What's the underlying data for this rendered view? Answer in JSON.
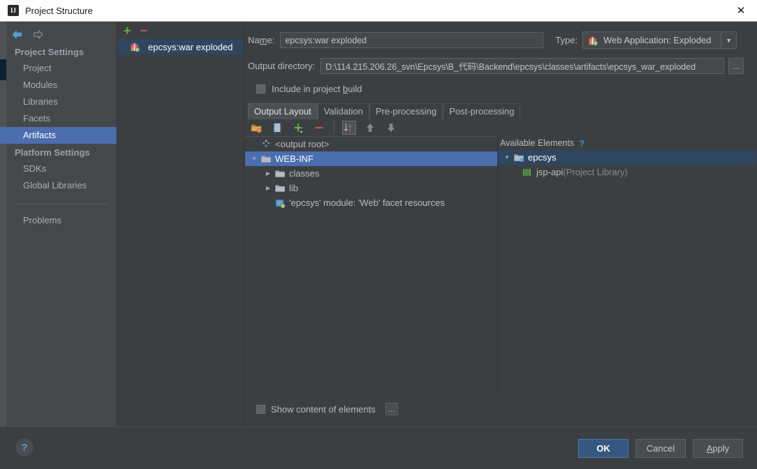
{
  "window": {
    "title": "Project Structure",
    "app_icon": "intellij-idea-icon",
    "close_icon": "close-icon"
  },
  "nav": {
    "back_icon": "arrow-back-icon",
    "forward_icon": "arrow-forward-icon"
  },
  "sidebar": {
    "groups": [
      {
        "label": "Project Settings",
        "items": [
          {
            "label": "Project",
            "selected": false
          },
          {
            "label": "Modules",
            "selected": false
          },
          {
            "label": "Libraries",
            "selected": false
          },
          {
            "label": "Facets",
            "selected": false
          },
          {
            "label": "Artifacts",
            "selected": true
          }
        ]
      },
      {
        "label": "Platform Settings",
        "items": [
          {
            "label": "SDKs",
            "selected": false
          },
          {
            "label": "Global Libraries",
            "selected": false
          }
        ]
      }
    ],
    "problems_label": "Problems"
  },
  "artifact_list": {
    "add_icon": "plus-icon",
    "remove_icon": "minus-icon",
    "items": [
      {
        "label": "epcsys:war exploded",
        "icon": "artifact-icon",
        "selected": true
      }
    ]
  },
  "detail": {
    "name_label": "Name:",
    "name_value": "epcsys:war exploded",
    "type_label": "Type:",
    "type_value": "Web Application: Exploded",
    "type_icon": "artifact-icon",
    "type_dropdown_icon": "chevron-down-icon",
    "output_dir_label": "Output directory:",
    "output_dir_value": "D:\\114.215.206.26_svn\\Epcsys\\B_代码\\Backend\\epcsys\\classes\\artifacts\\epcsys_war_exploded",
    "output_dir_browse_label": "...",
    "include_in_build_label": "Include in project build",
    "include_in_build_checked": false,
    "tabs": [
      {
        "label": "Output Layout",
        "active": true
      },
      {
        "label": "Validation",
        "active": false
      },
      {
        "label": "Pre-processing",
        "active": false
      },
      {
        "label": "Post-processing",
        "active": false
      }
    ],
    "layout_toolbar": [
      {
        "name": "add-directory-icon",
        "toggled": false
      },
      {
        "name": "add-archive-icon",
        "toggled": false
      },
      {
        "name": "plus-icon",
        "toggled": false
      },
      {
        "name": "minus-icon",
        "toggled": false
      },
      {
        "name": "sort-alphabetically-icon",
        "toggled": true
      },
      {
        "name": "move-up-icon",
        "toggled": false
      },
      {
        "name": "move-down-icon",
        "toggled": false
      }
    ],
    "output_tree": [
      {
        "label": "<output root>",
        "icon": "output-root-icon",
        "indent": 0,
        "twisty": "none",
        "selected": false
      },
      {
        "label": "WEB-INF",
        "icon": "folder-icon",
        "indent": 0,
        "twisty": "expanded",
        "selected": true
      },
      {
        "label": "classes",
        "icon": "folder-icon",
        "indent": 1,
        "twisty": "collapsed",
        "selected": false
      },
      {
        "label": "lib",
        "icon": "folder-icon",
        "indent": 1,
        "twisty": "collapsed",
        "selected": false
      },
      {
        "label": "'epcsys' module: 'Web' facet resources",
        "icon": "module-facet-icon",
        "indent": 1,
        "twisty": "none",
        "selected": false
      }
    ],
    "available_elements_label": "Available Elements",
    "available_help_icon": "help-question-icon",
    "available_tree": [
      {
        "label": "epcsys",
        "suffix": "",
        "icon": "module-icon",
        "indent": 0,
        "twisty": "expanded",
        "selected": true
      },
      {
        "label": "jsp-api",
        "suffix": " (Project Library)",
        "icon": "library-icon",
        "indent": 1,
        "twisty": "none",
        "selected": false
      }
    ],
    "show_content_label": "Show content of elements",
    "show_content_checked": false,
    "show_content_browse_label": "..."
  },
  "footer": {
    "help_label": "?",
    "buttons": [
      {
        "label": "OK",
        "primary": true
      },
      {
        "label": "Cancel",
        "primary": false
      },
      {
        "label": "Apply",
        "primary": false
      }
    ]
  },
  "colors": {
    "selection_blue": "#4b6eaf",
    "selection_dark": "#2f4661",
    "accent_blue": "#3592c4",
    "green": "#62b543",
    "red": "#c75450",
    "panel_bg": "#3c3f41",
    "sidebar_bg": "#45484a",
    "primary_button": "#365880"
  }
}
